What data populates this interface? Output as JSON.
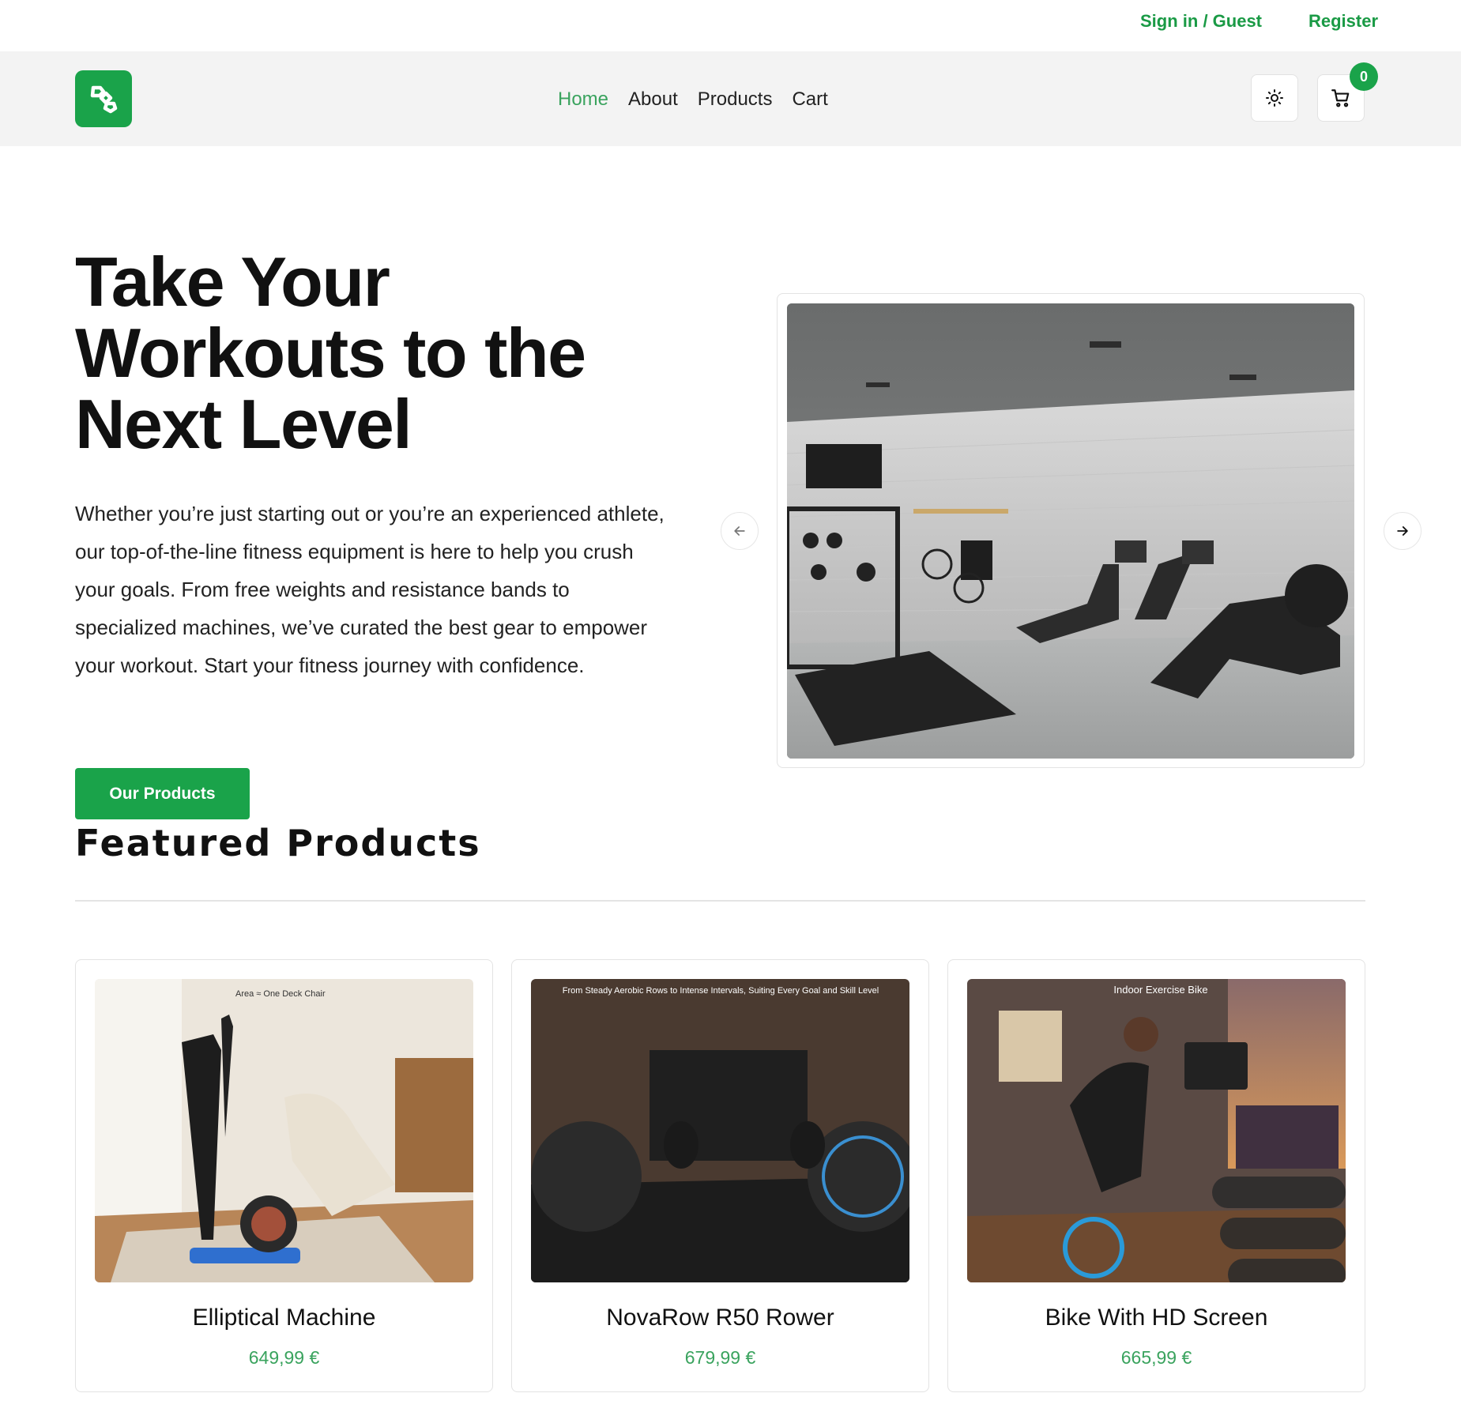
{
  "topbar": {
    "signin": "Sign in / Guest",
    "register": "Register"
  },
  "nav": {
    "links": [
      "Home",
      "About",
      "Products",
      "Cart"
    ],
    "active": "Home",
    "cart_count": "0"
  },
  "hero": {
    "title": "Take Your Workouts to the Next Level",
    "text": "Whether you’re just starting out or you’re an experienced athlete, our top-of-the-line fitness equipment is here to help you crush your goals. From free weights and resistance bands to specialized machines, we’ve curated the best gear to empower your workout. Start your fitness journey with confidence.",
    "cta": "Our Products"
  },
  "featured": {
    "title": "Featured Products",
    "products": [
      {
        "name": "Elliptical Machine",
        "price": "649,99 €",
        "image_caption": "Area ≈ One Deck Chair"
      },
      {
        "name": "NovaRow R50 Rower",
        "price": "679,99 €",
        "image_caption": "From Steady Aerobic Rows to Intense Intervals, Suiting Every Goal and Skill Level"
      },
      {
        "name": "Bike With HD Screen",
        "price": "665,99 €",
        "image_caption": "Indoor Exercise Bike"
      }
    ]
  },
  "colors": {
    "accent": "#1aa34a",
    "price": "#3aa35e",
    "navbar_bg": "#f3f3f3"
  },
  "icons": [
    "logo-icon",
    "sun-icon",
    "cart-icon",
    "arrow-left-icon",
    "arrow-right-icon"
  ]
}
